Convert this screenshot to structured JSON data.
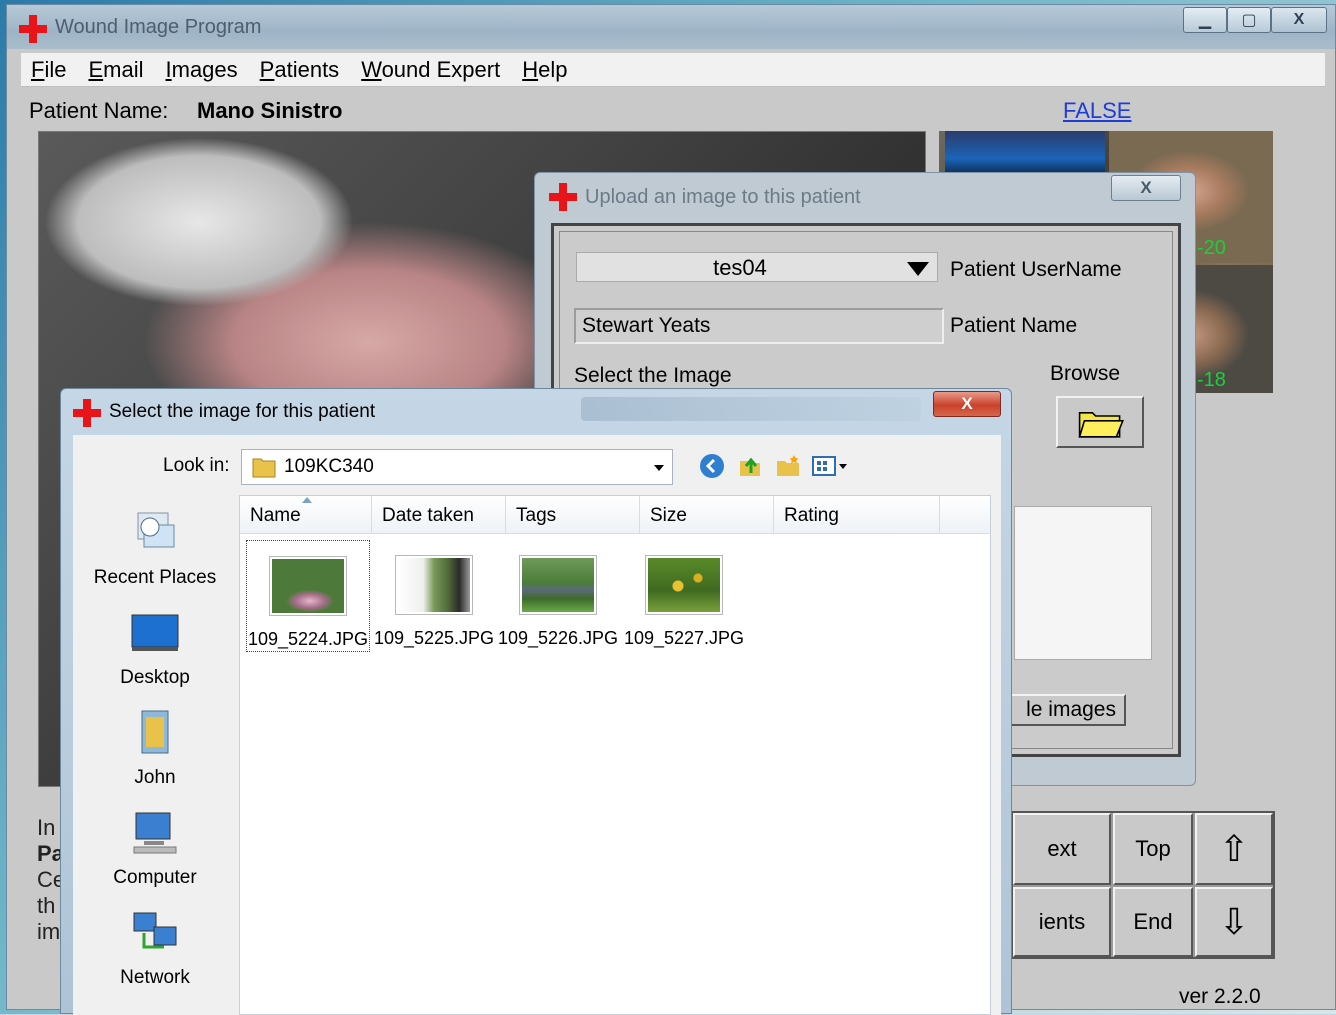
{
  "main_window": {
    "title": "Wound Image Program",
    "menu": [
      "File",
      "Email",
      "Images",
      "Patients",
      "Wound Expert",
      "Help"
    ],
    "patient_name_label": "Patient Name:",
    "patient_name_value": "Mano Sinistro",
    "false_link": "FALSE",
    "thumb_numbers": [
      "-20",
      "-18"
    ],
    "info_lines": [
      "In",
      "Pa",
      "Ce",
      "th",
      "im"
    ],
    "nav_buttons": {
      "next": "ext",
      "top": "Top",
      "up_icon": "⇧",
      "patients": "ients",
      "end": "End",
      "down_icon": "⇩"
    },
    "version": "ver 2.2.0"
  },
  "upload_dialog": {
    "title": "Upload an image to this patient",
    "close_label": "X",
    "username_value": "tes04",
    "username_label": "Patient UserName",
    "patient_name_value": "Stewart Yeats",
    "patient_name_label": "Patient Name",
    "select_label": "Select the Image",
    "browse_label": "Browse",
    "images_button": "le images"
  },
  "file_dialog": {
    "title": "Select the image for this patient",
    "close_label": "X",
    "lookin_label": "Look in:",
    "lookin_value": "109KC340",
    "places": [
      "Recent Places",
      "Desktop",
      "John",
      "Computer",
      "Network"
    ],
    "columns": [
      "Name",
      "Date taken",
      "Tags",
      "Size",
      "Rating"
    ],
    "files": [
      "109_5224.JPG",
      "109_5225.JPG",
      "109_5226.JPG",
      "109_5227.JPG"
    ]
  },
  "colors": {
    "accent_red": "#e8141a",
    "link_blue": "#1e3cd8",
    "thumb_green": "#19d13a"
  }
}
